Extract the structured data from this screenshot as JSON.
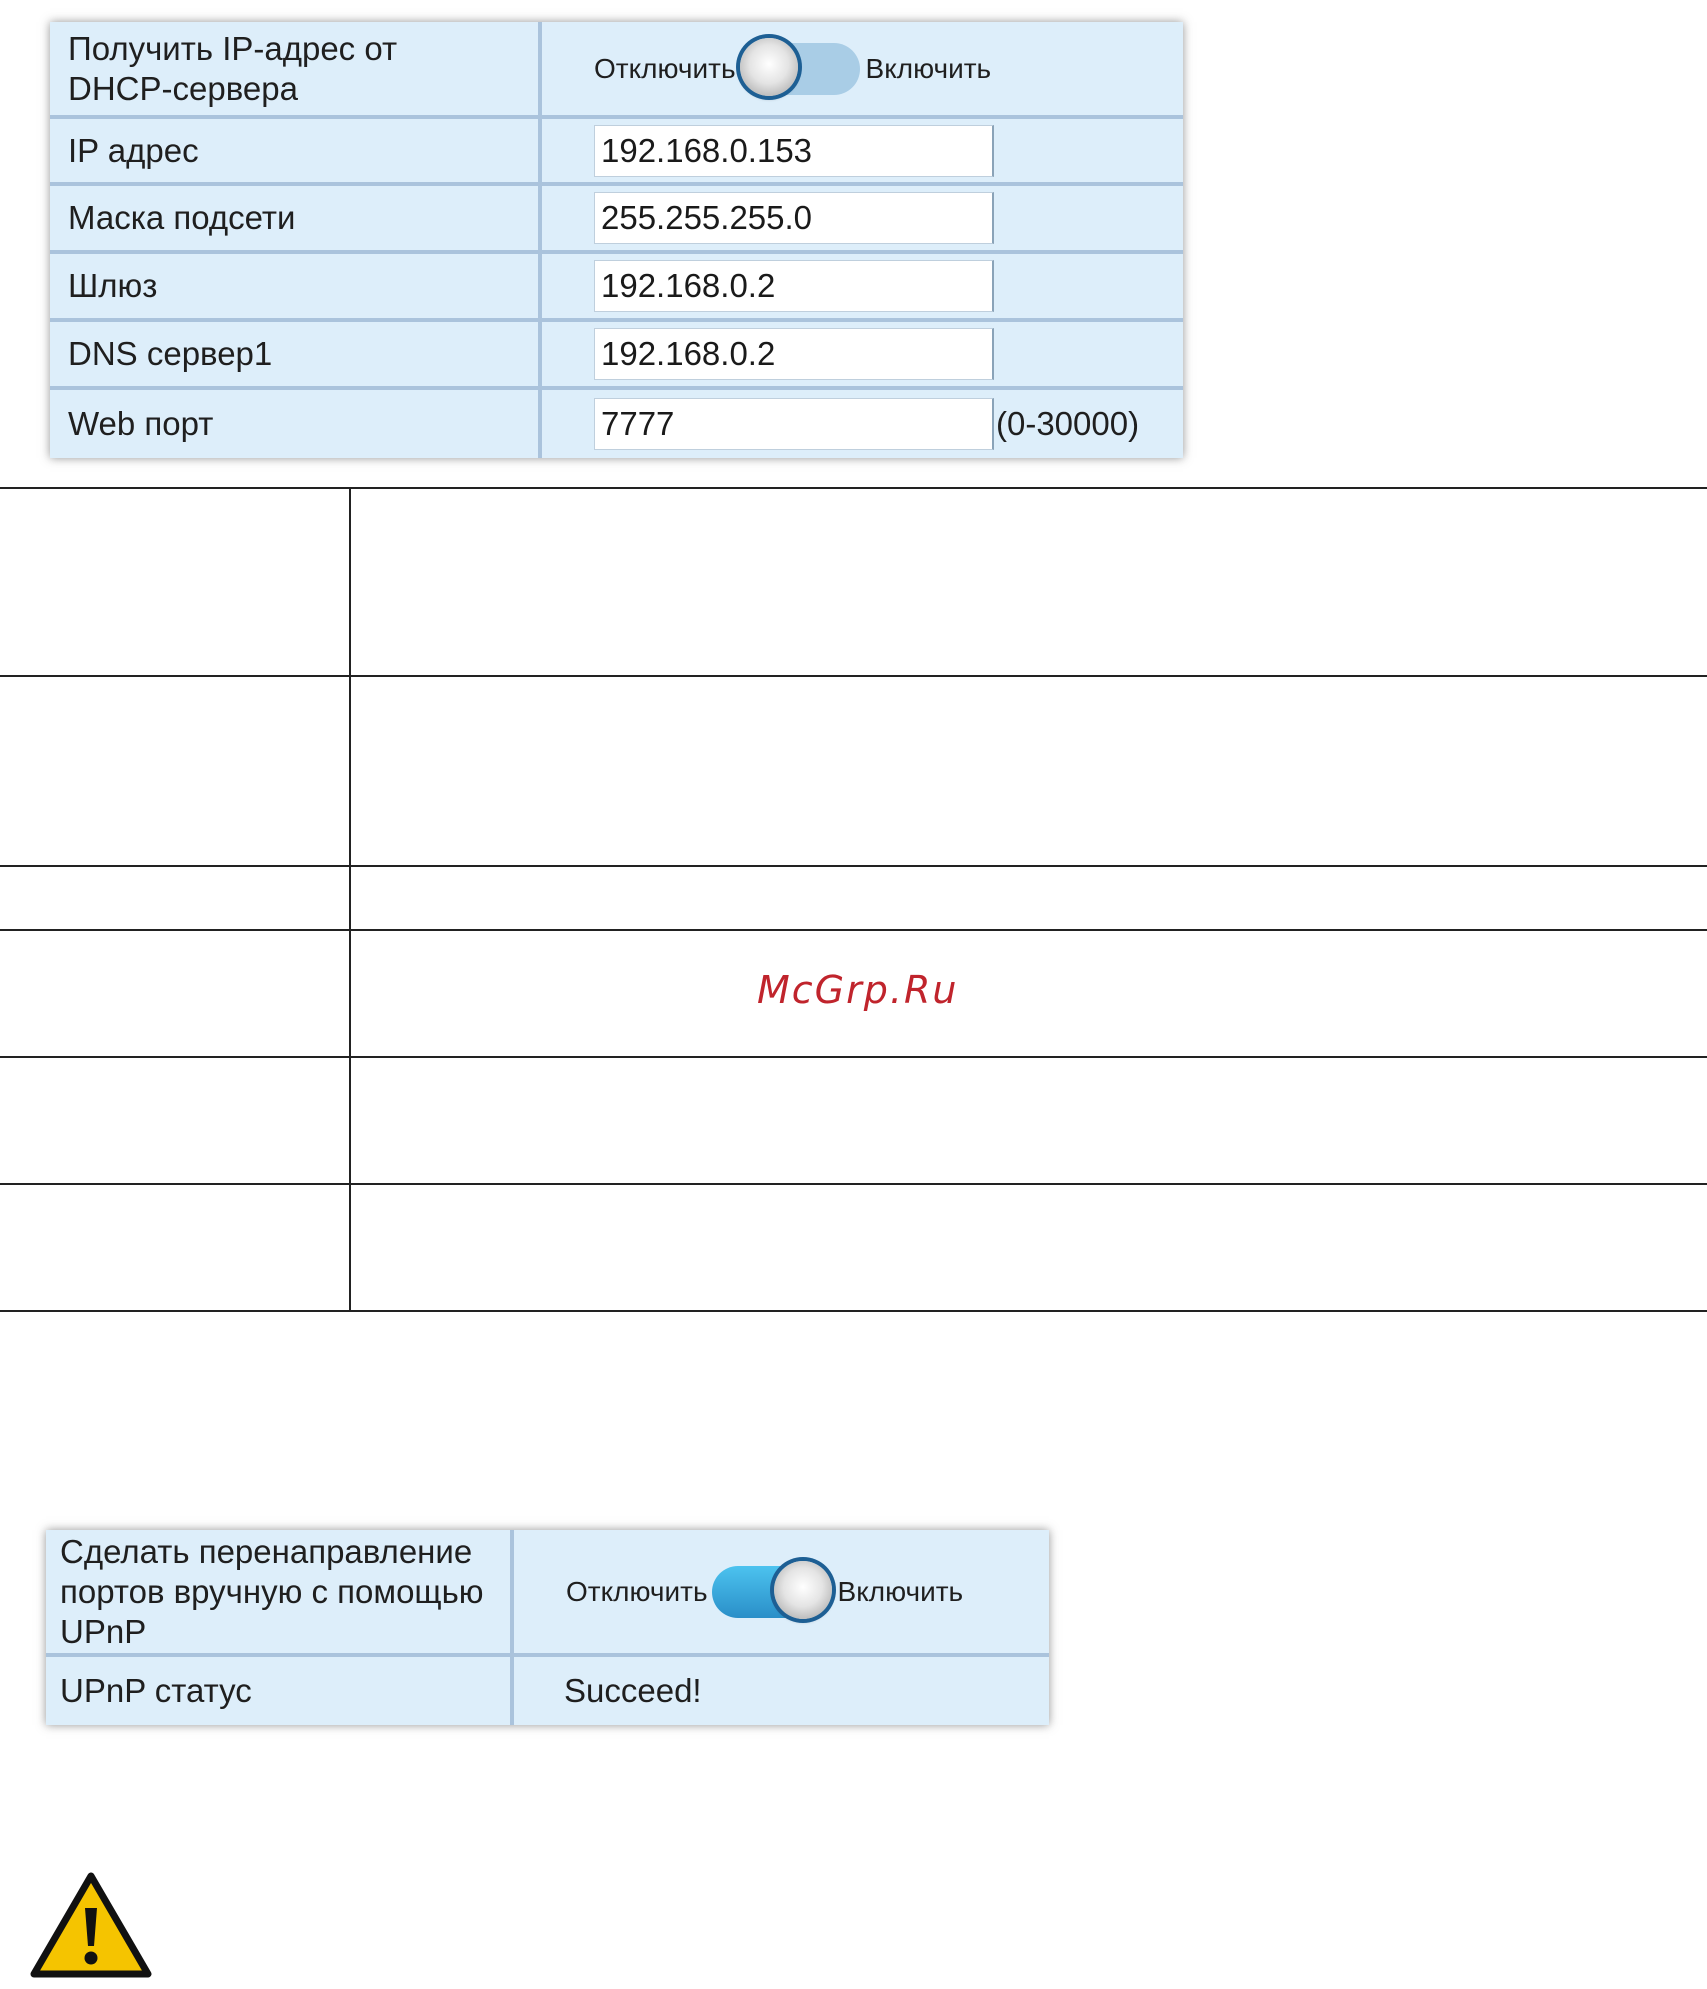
{
  "network_settings": {
    "dhcp": {
      "label": "Получить IP-адрес от DHCP-сервера",
      "off_label": "Отключить",
      "on_label": "Включить",
      "state": "off"
    },
    "ip": {
      "label": "IP адрес",
      "value": "192.168.0.153"
    },
    "subnet": {
      "label": "Маска подсети",
      "value": "255.255.255.0"
    },
    "gateway": {
      "label": "Шлюз",
      "value": "192.168.0.2"
    },
    "dns1": {
      "label": "DNS сервер1",
      "value": "192.168.0.2"
    },
    "web_port": {
      "label": "Web порт",
      "value": "7777",
      "range": "(0-30000)"
    }
  },
  "watermark": "McGrp.Ru",
  "upnp": {
    "forward": {
      "label": "Сделать перенаправление портов вручную с помощью UPnP",
      "off_label": "Отключить",
      "on_label": "Включить",
      "state": "on"
    },
    "status": {
      "label": "UPnP статус",
      "value": "Succeed!"
    }
  },
  "icons": {
    "warning": "warning-icon"
  },
  "colors": {
    "panel_bg": "#ddeefa",
    "toggle_on": "#2a8fc8",
    "watermark": "#c0242c",
    "warning_fill": "#f5c400"
  }
}
